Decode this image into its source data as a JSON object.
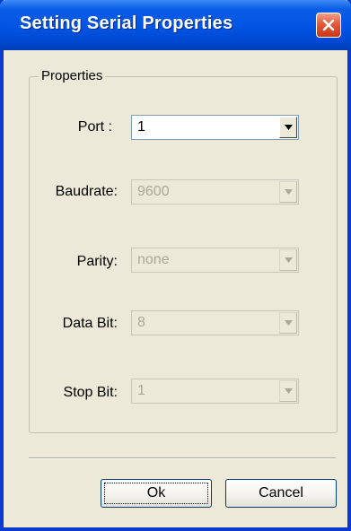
{
  "window": {
    "title": "Setting Serial Properties"
  },
  "group": {
    "label": "Properties"
  },
  "fields": [
    {
      "label": "Port :",
      "value": "1",
      "enabled": true
    },
    {
      "label": "Baudrate:",
      "value": "9600",
      "enabled": false
    },
    {
      "label": "Parity:",
      "value": "none",
      "enabled": false
    },
    {
      "label": "Data Bit:",
      "value": "8",
      "enabled": false
    },
    {
      "label": "Stop Bit:",
      "value": "1",
      "enabled": false
    }
  ],
  "buttons": {
    "ok_label": "Ok",
    "cancel_label": "Cancel"
  },
  "icons": {
    "close": "close-icon",
    "dropdown": "chevron-down-icon"
  },
  "colors": {
    "titlebar": "#0054e3",
    "close_button": "#e4593a",
    "dialog_background": "#ece9d8",
    "disabled_text": "#aca899"
  }
}
